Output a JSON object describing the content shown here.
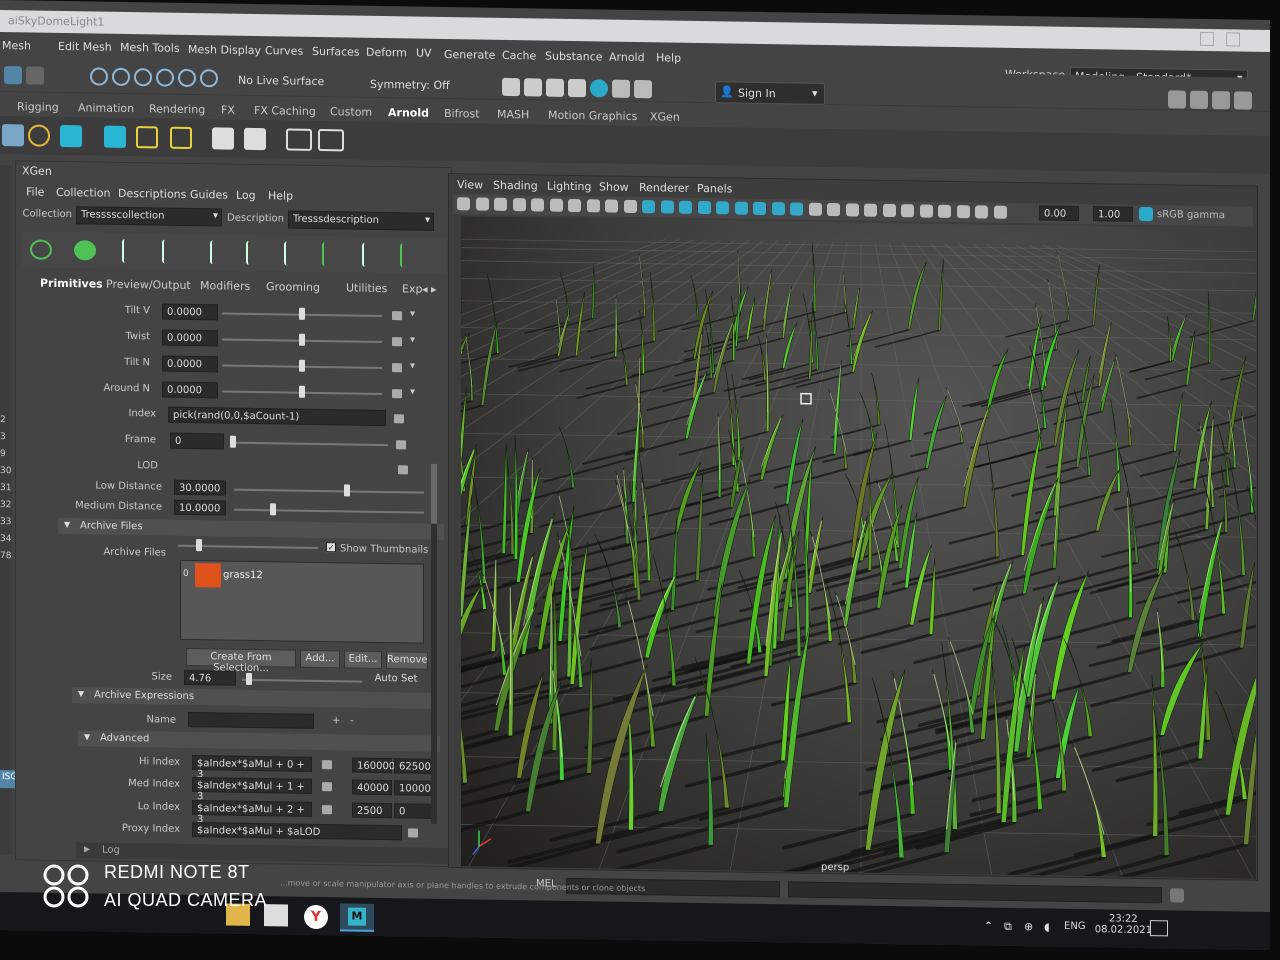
{
  "window": {
    "title": "aiSkyDomeLight1"
  },
  "menubar": [
    "Mesh",
    "Edit Mesh",
    "Mesh Tools",
    "Mesh Display",
    "Curves",
    "Surfaces",
    "Deform",
    "UV",
    "Generate",
    "Cache",
    "Substance",
    "Arnold",
    "Help"
  ],
  "toolbar": {
    "live_surface": "No Live Surface",
    "symmetry": "Symmetry: Off",
    "sign_in": "Sign In",
    "workspace_label": "Workspace :",
    "workspace_value": "Modeling - Standard*"
  },
  "shelf_tabs": [
    "Rigging",
    "Animation",
    "Rendering",
    "FX",
    "FX Caching",
    "Custom",
    "Arnold",
    "Bifrost",
    "MASH",
    "Motion Graphics",
    "XGen"
  ],
  "shelf_active": "Arnold",
  "xgen": {
    "title": "XGen",
    "menu": [
      "File",
      "Collection",
      "Descriptions",
      "Guides",
      "Log",
      "Help"
    ],
    "collection_label": "Collection",
    "collection_value": "Tresssscollection",
    "description_label": "Description",
    "description_value": "Tresssdescription",
    "tabs": [
      "Primitives",
      "Preview/Output",
      "Modifiers",
      "Grooming",
      "Utilities",
      "Exp"
    ],
    "active_tab": "Primitives",
    "params": [
      {
        "label": "Tilt V",
        "value": "0.0000",
        "slider": 0.5
      },
      {
        "label": "Twist",
        "value": "0.0000",
        "slider": 0.5
      },
      {
        "label": "Tilt N",
        "value": "0.0000",
        "slider": 0.5
      },
      {
        "label": "Around N",
        "value": "0.0000",
        "slider": 0.5
      }
    ],
    "index_label": "Index",
    "index_value": "pick(rand(0,0,$aCount-1)",
    "frame_label": "Frame",
    "frame_value": "0",
    "lod_label": "LOD",
    "low_distance_label": "Low Distance",
    "low_distance_value": "30.0000",
    "medium_distance_label": "Medium Distance",
    "medium_distance_value": "10.0000",
    "archive_files_section": "Archive Files",
    "archive_files_label": "Archive Files",
    "show_thumbnails": "Show Thumbnails",
    "archive_item_index": "0",
    "archive_item_name": "grass12",
    "buttons": [
      "Create From Selection...",
      "Add...",
      "Edit...",
      "Remove"
    ],
    "size_label": "Size",
    "size_value": "4.76",
    "auto_set": "Auto Set",
    "archive_expressions_section": "Archive Expressions",
    "name_label": "Name",
    "advanced_section": "Advanced",
    "advanced": [
      {
        "label": "Hi Index",
        "expr": "$aIndex*$aMul + 0 + 3",
        "a": "160000",
        "b": "62500"
      },
      {
        "label": "Med Index",
        "expr": "$aIndex*$aMul + 1 + 3",
        "a": "40000",
        "b": "10000"
      },
      {
        "label": "Lo Index",
        "expr": "$aIndex*$aMul + 2 + 3",
        "a": "2500",
        "b": "0"
      },
      {
        "label": "Proxy Index",
        "expr": "$aIndex*$aMul + $aLOD",
        "a": "",
        "b": ""
      }
    ],
    "log_label": "Log"
  },
  "outliner_numbers": [
    "2",
    "3",
    "9",
    "30",
    "31",
    "32",
    "33",
    "34",
    "78"
  ],
  "outliner_selected": "ISG_materi",
  "viewport": {
    "menu": [
      "View",
      "Shading",
      "Lighting",
      "Show",
      "Renderer",
      "Panels"
    ],
    "field_a": "0.00",
    "field_b": "1.00",
    "color_space": "sRGB gamma",
    "camera": "persp"
  },
  "command": {
    "mel": "MEL",
    "help_text": "...move or scale manipulator axis or plane handles to extrude components or clone objects"
  },
  "taskbar": {
    "lang": "ENG",
    "time": "23:22",
    "date": "08.02.2021"
  },
  "watermark": {
    "line1": "REDMI NOTE 8T",
    "line2": "AI QUAD CAMERA"
  }
}
